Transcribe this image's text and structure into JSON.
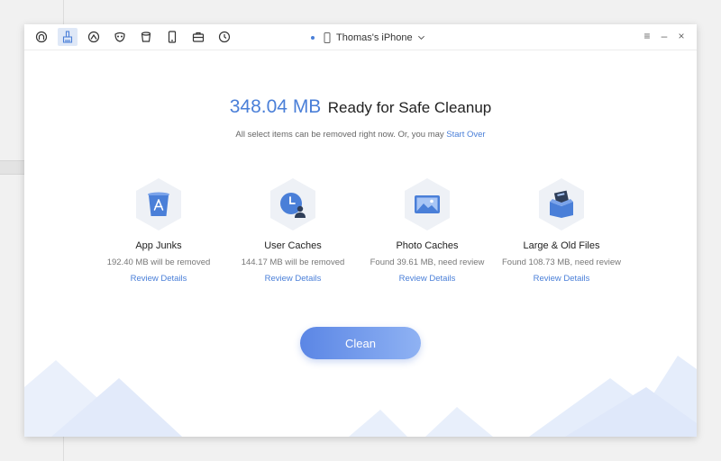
{
  "toolbar": {
    "tools": [
      {
        "name": "quick-manage-icon",
        "active": false
      },
      {
        "name": "cleanup-brush-icon",
        "active": true
      },
      {
        "name": "clock-cleanup-icon",
        "active": false
      },
      {
        "name": "privacy-mask-icon",
        "active": false
      },
      {
        "name": "trash-bin-icon",
        "active": false
      },
      {
        "name": "device-phone-icon",
        "active": false
      },
      {
        "name": "toolbox-icon",
        "active": false
      },
      {
        "name": "history-icon",
        "active": false
      }
    ]
  },
  "device": {
    "name": "Thomas's iPhone"
  },
  "window_controls": {
    "menu": "≡",
    "minimize": "–",
    "close": "×"
  },
  "summary": {
    "size": "348.04 MB",
    "status": "Ready for Safe Cleanup",
    "subtitle": "All select items can be removed right now. Or, you may",
    "start_over": "Start Over"
  },
  "categories": [
    {
      "title": "App Junks",
      "desc": "192.40 MB will be removed",
      "link": "Review Details",
      "icon": "app-store-bin-icon"
    },
    {
      "title": "User Caches",
      "desc": "144.17 MB will be removed",
      "link": "Review Details",
      "icon": "user-clock-icon"
    },
    {
      "title": "Photo Caches",
      "desc": "Found 39.61 MB, need review",
      "link": "Review Details",
      "icon": "photo-icon"
    },
    {
      "title": "Large & Old Files",
      "desc": "Found 108.73 MB, need review",
      "link": "Review Details",
      "icon": "file-box-icon"
    }
  ],
  "clean_button": "Clean",
  "colors": {
    "accent": "#4a7fd8",
    "hex_bg": "#eef1f6",
    "mountain": "#e6eefb"
  }
}
